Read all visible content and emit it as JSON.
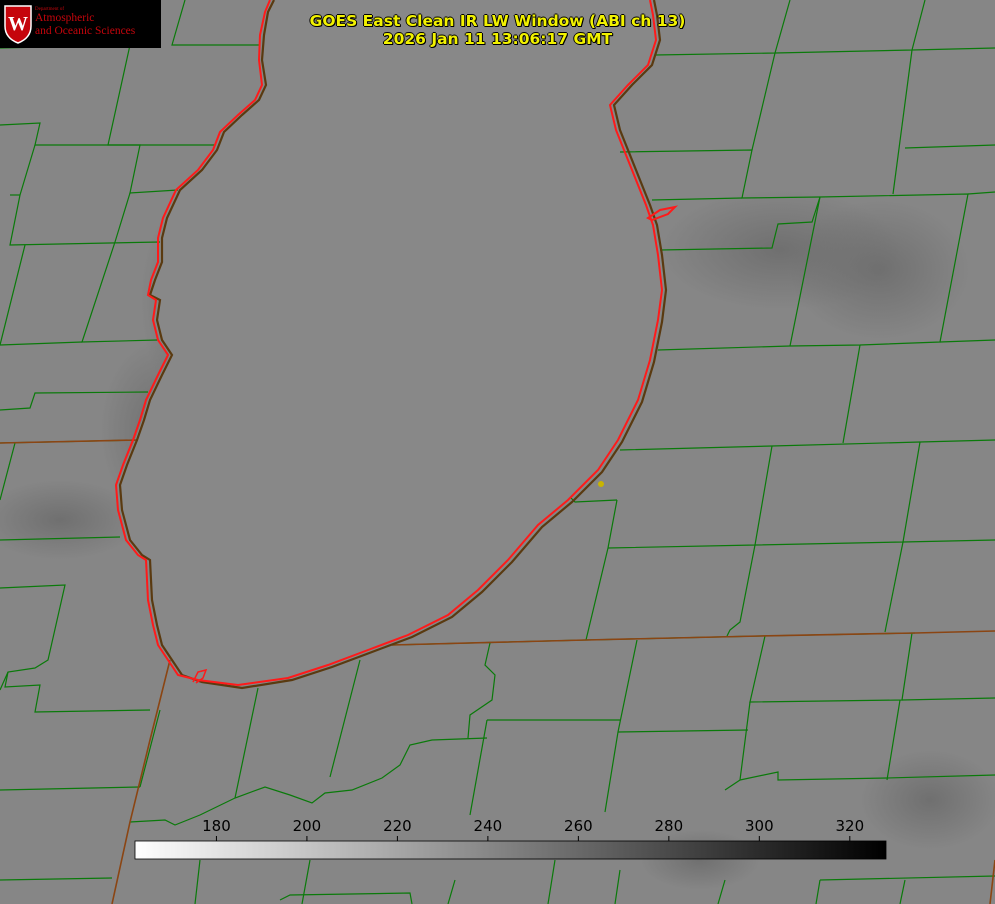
{
  "title": {
    "line1": "GOES East Clean IR LW Window (ABI ch 13)",
    "line2": "2026 Jan 11 13:06:17 GMT"
  },
  "logo": {
    "department": "Department of",
    "line1": "Atmospheric",
    "line2": "and Oceanic Sciences",
    "crest_letter": "W",
    "color": "#c5050c"
  },
  "colorbar": {
    "ticks": [
      "180",
      "200",
      "220",
      "240",
      "260",
      "280",
      "300",
      "320"
    ],
    "tick_values": [
      180,
      200,
      220,
      240,
      260,
      280,
      300,
      320
    ],
    "min": 162,
    "max": 328,
    "low_color": "#ffffff",
    "high_color": "#000000"
  },
  "colors": {
    "background": "#848484",
    "county_lines": "#0a7a0a",
    "shoreline": "#ff1a1a",
    "state_lines": "#8b4513",
    "title_text": "#f2f200",
    "marker": "#c8b400"
  }
}
